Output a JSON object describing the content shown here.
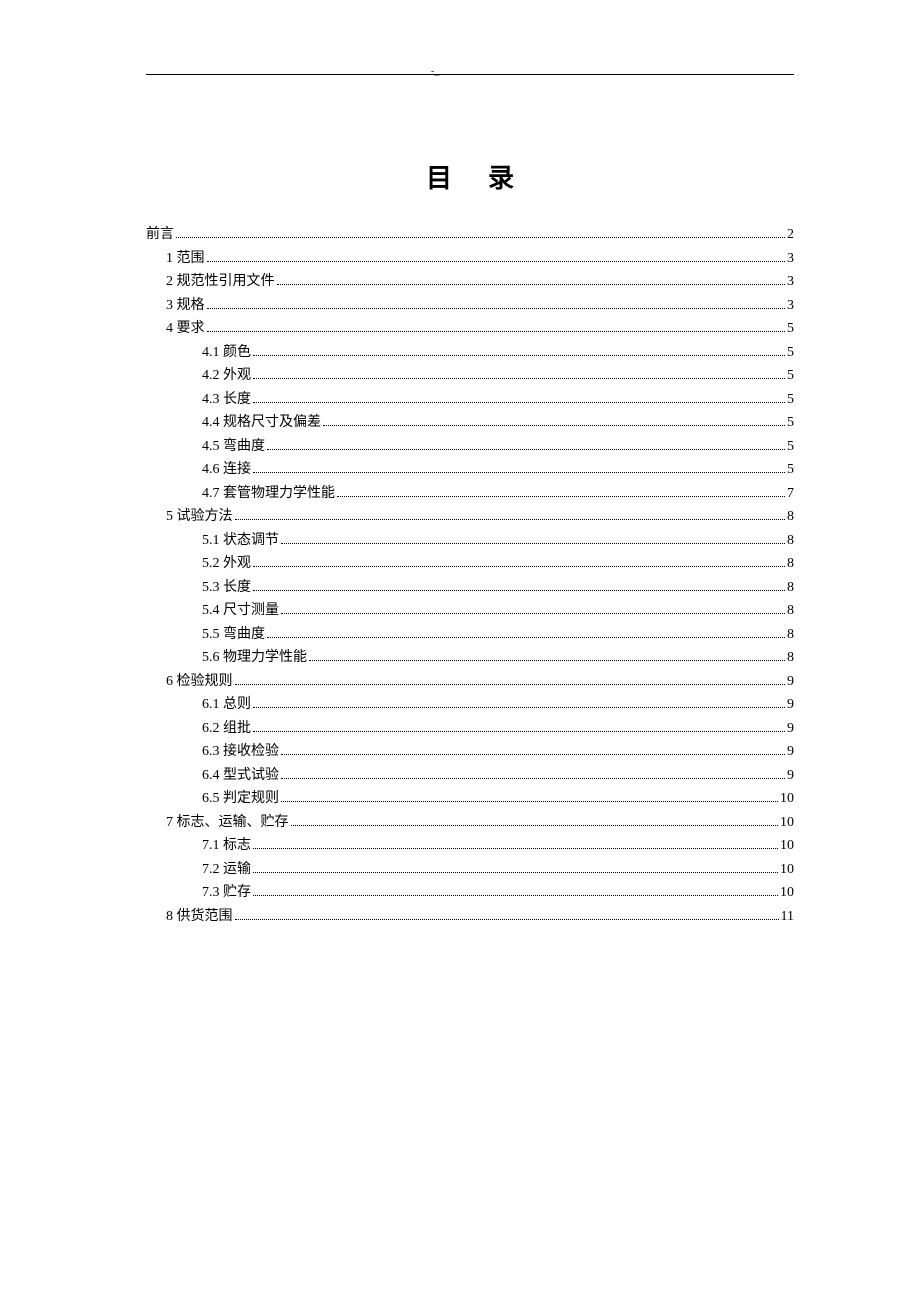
{
  "header_mark": "-_",
  "title": "目录",
  "toc": [
    {
      "indent": 0,
      "num": "",
      "label": "前言",
      "page": "2"
    },
    {
      "indent": 1,
      "num": "1",
      "label": "范围",
      "page": "3"
    },
    {
      "indent": 1,
      "num": "2",
      "label": "规范性引用文件",
      "page": "3"
    },
    {
      "indent": 1,
      "num": "3",
      "label": "规格",
      "page": "3"
    },
    {
      "indent": 1,
      "num": "4",
      "label": "要求",
      "page": "5"
    },
    {
      "indent": 2,
      "num": "4.1",
      "label": "颜色",
      "page": "5"
    },
    {
      "indent": 2,
      "num": "4.2",
      "label": "外观",
      "page": "5"
    },
    {
      "indent": 2,
      "num": "4.3",
      "label": "长度",
      "page": "5"
    },
    {
      "indent": 2,
      "num": "4.4",
      "label": "规格尺寸及偏差",
      "page": "5"
    },
    {
      "indent": 2,
      "num": "4.5",
      "label": "弯曲度",
      "page": "5"
    },
    {
      "indent": 2,
      "num": "4.6",
      "label": "连接",
      "page": "5"
    },
    {
      "indent": 2,
      "num": "4.7",
      "label": "套管物理力学性能",
      "page": "7"
    },
    {
      "indent": 1,
      "num": "5",
      "label": "试验方法",
      "page": "8"
    },
    {
      "indent": 2,
      "num": "5.1",
      "label": "状态调节",
      "page": "8"
    },
    {
      "indent": 2,
      "num": "5.2",
      "label": "外观",
      "page": "8"
    },
    {
      "indent": 2,
      "num": "5.3",
      "label": "长度",
      "page": "8"
    },
    {
      "indent": 2,
      "num": "5.4",
      "label": "尺寸测量",
      "page": "8"
    },
    {
      "indent": 2,
      "num": "5.5",
      "label": "弯曲度",
      "page": "8"
    },
    {
      "indent": 2,
      "num": "5.6",
      "label": "物理力学性能",
      "page": "8"
    },
    {
      "indent": 1,
      "num": "6",
      "label": "检验规则",
      "page": "9"
    },
    {
      "indent": 2,
      "num": "6.1",
      "label": "总则",
      "page": "9"
    },
    {
      "indent": 2,
      "num": "6.2",
      "label": "组批",
      "page": "9"
    },
    {
      "indent": 2,
      "num": "6.3",
      "label": "接收检验",
      "page": "9"
    },
    {
      "indent": 2,
      "num": "6.4",
      "label": "型式试验",
      "page": "9"
    },
    {
      "indent": 2,
      "num": "6.5",
      "label": "判定规则",
      "page": "10"
    },
    {
      "indent": 1,
      "num": "7",
      "label": "标志、运输、贮存",
      "page": "10"
    },
    {
      "indent": 2,
      "num": "7.1",
      "label": "标志",
      "page": "10"
    },
    {
      "indent": 2,
      "num": "7.2",
      "label": "运输",
      "page": "10"
    },
    {
      "indent": 2,
      "num": "7.3",
      "label": "贮存",
      "page": "10"
    },
    {
      "indent": 1,
      "num": "8",
      "label": "供货范围",
      "page": "11"
    }
  ]
}
